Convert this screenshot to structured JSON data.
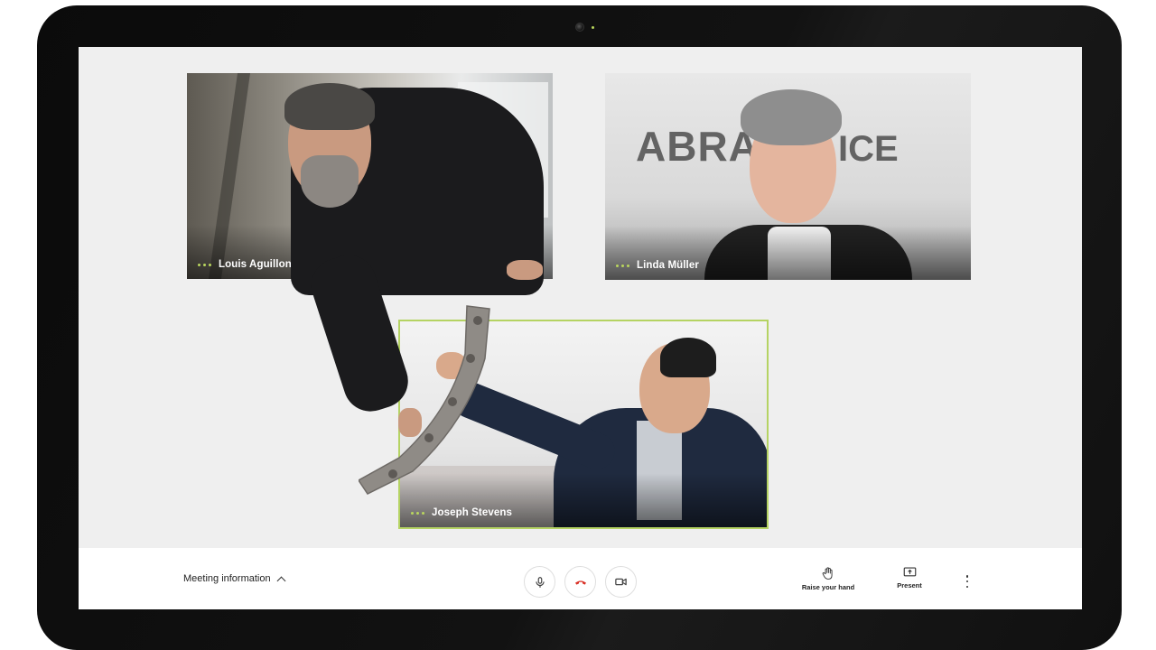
{
  "participants": [
    {
      "name": "Louis Aguillon"
    },
    {
      "name": "Linda Müller",
      "background_sign_left": "ABRA",
      "background_sign_right": "ICE"
    },
    {
      "name": "Joseph Stevens",
      "active_speaker": true
    }
  ],
  "bottom_bar": {
    "meeting_info_label": "Meeting information",
    "raise_hand_label": "Raise your hand",
    "present_label": "Present",
    "icons": {
      "mic": "microphone-icon",
      "hangup": "hang-up-icon",
      "camera": "camera-icon",
      "raise_hand": "hand-icon",
      "present": "present-screen-icon",
      "more": "more-vertical-icon"
    }
  },
  "colors": {
    "accent": "#b5d363",
    "hangup": "#d93025",
    "screen_bg": "#efefef"
  }
}
